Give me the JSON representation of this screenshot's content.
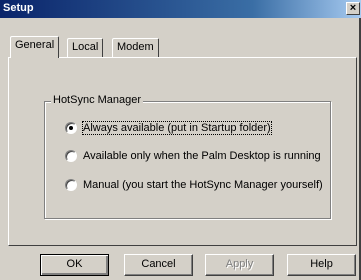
{
  "window": {
    "title": "Setup",
    "close_glyph": "×"
  },
  "tabs": [
    {
      "label": "General",
      "active": true
    },
    {
      "label": "Local",
      "active": false
    },
    {
      "label": "Modem",
      "active": false
    }
  ],
  "group": {
    "label": "HotSync Manager",
    "options": [
      {
        "label": "Always available (put in Startup folder)",
        "checked": true
      },
      {
        "label": "Available only when the Palm Desktop is running",
        "checked": false
      },
      {
        "label": "Manual (you start the HotSync Manager yourself)",
        "checked": false
      }
    ]
  },
  "buttons": {
    "ok": "OK",
    "cancel": "Cancel",
    "apply": "Apply",
    "help": "Help"
  }
}
